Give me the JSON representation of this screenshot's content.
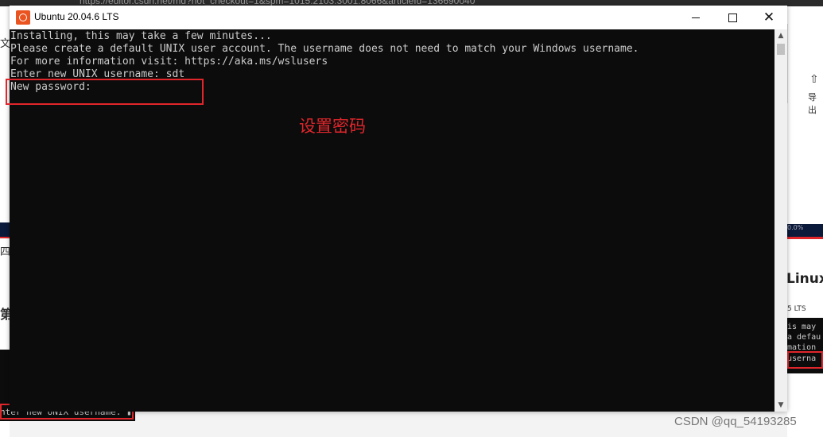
{
  "background": {
    "url_text": "https://editor.csdn.net/md?not_checkout=1&spm=1015.2103.3001.8066&articleId=136690040",
    "export_label": "导出",
    "left_partial_chars": [
      "文",
      "四",
      "第"
    ],
    "left_terminal_line": "nter new UNIX username: ▮",
    "right_heading": "Linux",
    "right_title": "5 LTS",
    "right_progress": "0.0%",
    "right_terminal_lines": [
      "is may",
      "a defau",
      "mation",
      "userna"
    ],
    "watermark": "CSDN @qq_54193285"
  },
  "window": {
    "title": "Ubuntu 20.04.6 LTS",
    "icon": "ubuntu-icon",
    "controls": {
      "minimize": "minimize-icon",
      "maximize": "maximize-icon",
      "close": "✕"
    }
  },
  "terminal": {
    "lines": [
      "Installing, this may take a few minutes...",
      "Please create a default UNIX user account. The username does not need to match your Windows username.",
      "For more information visit: https://aka.ms/wslusers",
      "Enter new UNIX username: sdt",
      "New password:"
    ]
  },
  "annotation": {
    "text": "设置密码",
    "color": "#e0262b"
  },
  "colors": {
    "console_bg": "#0c0c0c",
    "console_fg": "#cccccc",
    "accent_red": "#e0262b",
    "ubuntu_orange": "#e95420"
  }
}
